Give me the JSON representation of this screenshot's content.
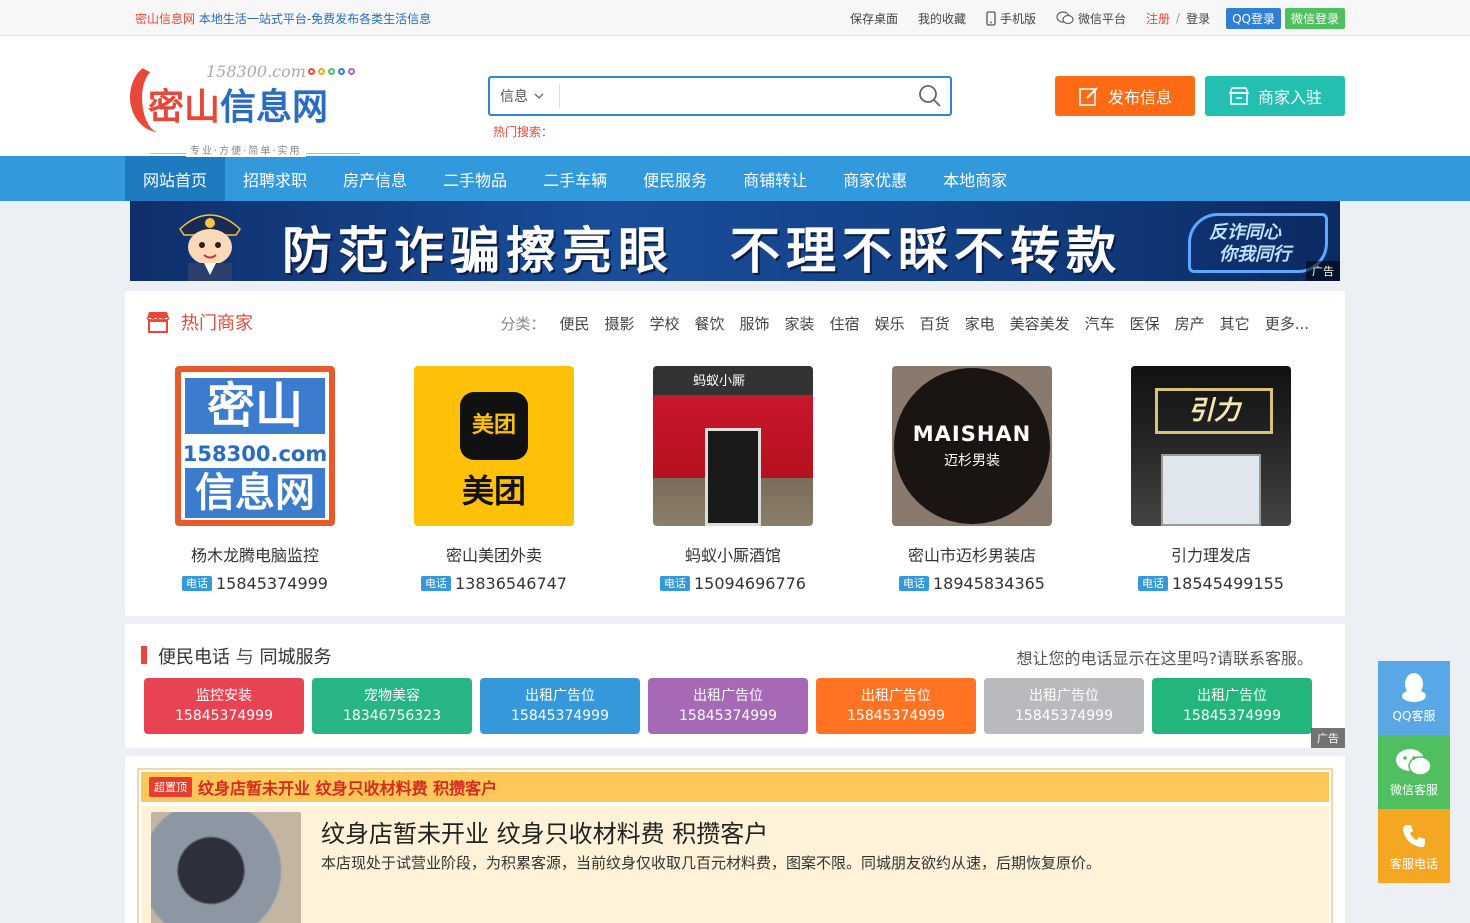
{
  "topbar": {
    "site_name": "密山信息网",
    "slogan": "本地生活一站式平台-免费发布各类生活信息",
    "save_desktop": "保存桌面",
    "favorites": "我的收藏",
    "mobile": "手机版",
    "wechat_platform": "微信平台",
    "register": "注册",
    "separator": "/",
    "login": "登录",
    "qq_login": "QQ登录",
    "wechat_login": "微信登录"
  },
  "logo": {
    "domain": "158300.com",
    "title_part1": "密山",
    "title_part2": "信息网",
    "tagline": "专业·方便·简单·实用"
  },
  "search": {
    "category": "信息",
    "placeholder": "",
    "hot_label": "热门搜索："
  },
  "actions": {
    "post": "发布信息",
    "merchant_join": "商家入驻"
  },
  "nav": [
    {
      "label": "网站首页",
      "active": true
    },
    {
      "label": "招聘求职"
    },
    {
      "label": "房产信息"
    },
    {
      "label": "二手物品"
    },
    {
      "label": "二手车辆"
    },
    {
      "label": "便民服务"
    },
    {
      "label": "商铺转让"
    },
    {
      "label": "商家优惠"
    },
    {
      "label": "本地商家"
    }
  ],
  "banner": {
    "text": "防范诈骗擦亮眼　不理不睬不转款",
    "badge_line1": "反诈同心",
    "badge_line2": "你我同行",
    "ad_tag": "广告"
  },
  "hot_merchants": {
    "title": "热门商家",
    "category_label": "分类：",
    "categories": [
      "便民",
      "摄影",
      "学校",
      "餐饮",
      "服饰",
      "家装",
      "住宿",
      "娱乐",
      "百货",
      "家电",
      "美容美发",
      "汽车",
      "医保",
      "房产",
      "其它",
      "更多..."
    ],
    "tel_tag": "电话",
    "items": [
      {
        "name": "杨木龙腾电脑监控",
        "phone": "15845374999",
        "img_text1": "密山",
        "img_text2": "158300.com",
        "img_text3": "信息网"
      },
      {
        "name": "密山美团外卖",
        "phone": "13836546747",
        "img_text1": "美团",
        "img_text2": "美团"
      },
      {
        "name": "蚂蚁小厮酒馆",
        "phone": "15094696776",
        "img_text1": "蚂蚁小厮"
      },
      {
        "name": "密山市迈杉男装店",
        "phone": "18945834365",
        "img_text1": "MAISHAN",
        "img_text2": "迈杉男装"
      },
      {
        "name": "引力理发店",
        "phone": "18545499155",
        "img_text1": "引力"
      }
    ]
  },
  "services": {
    "title_a": "便民电话",
    "title_b": " 与 ",
    "title_c": "同城服务",
    "note": "想让您的电话显示在这里吗?请联系客服。",
    "ad_tag": "广告",
    "tiles": [
      {
        "label": "监控安装",
        "phone": "15845374999",
        "color": "#e84352"
      },
      {
        "label": "宠物美容",
        "phone": "18346756323",
        "color": "#27b586"
      },
      {
        "label": "出租广告位",
        "phone": "15845374999",
        "color": "#3498db"
      },
      {
        "label": "出租广告位",
        "phone": "15845374999",
        "color": "#a569b5"
      },
      {
        "label": "出租广告位",
        "phone": "15845374999",
        "color": "#ff7323"
      },
      {
        "label": "出租广告位",
        "phone": "15845374999",
        "color": "#b9babd"
      },
      {
        "label": "出租广告位",
        "phone": "15845374999",
        "color": "#22b57c"
      }
    ]
  },
  "top_post": {
    "badge": "超置顶",
    "strip_title": "纹身店暂未开业 纹身只收材料费 积攒客户",
    "title": "纹身店暂未开业 纹身只收材料费 积攒客户",
    "desc": "本店现处于试营业阶段，为积累客源，当前纹身仅收取几百元材料费，图案不限。同城朋友欲约从速，后期恢复原价。"
  },
  "floating": {
    "qq": "QQ客服",
    "wechat": "微信客服",
    "phone": "客服电话"
  },
  "colors": {
    "primary": "#3399dd",
    "accent_red": "#e8473a",
    "post_orange": "#ff6a14",
    "merchant_teal": "#23bfb0"
  }
}
